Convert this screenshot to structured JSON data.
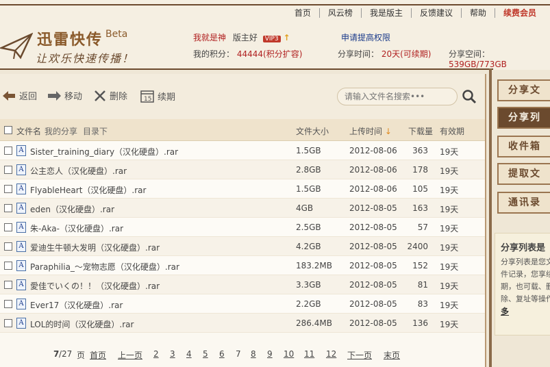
{
  "topnav": {
    "items": [
      {
        "label": "首页",
        "highlight": false
      },
      {
        "label": "风云榜",
        "highlight": false
      },
      {
        "label": "我是版主",
        "highlight": false
      },
      {
        "label": "反馈建议",
        "highlight": false
      },
      {
        "label": "帮助",
        "highlight": false
      },
      {
        "label": "续费会员",
        "highlight": true
      }
    ]
  },
  "logo": {
    "title": "迅雷快传",
    "beta": "Beta",
    "slogan": "让欢乐快速传播！"
  },
  "user": {
    "name": "我就是神",
    "role": "版主好",
    "vip": "VIP3",
    "score_label": "我的积分：",
    "score_value": "44444(积分扩容)",
    "permission_link": "申请提高权限",
    "share_time_label": "分享时间：",
    "share_time_value": "20天(可续期)",
    "space_label": "分享空间：",
    "space_value": "539GB/773GB"
  },
  "toolbar": {
    "back": "返回",
    "move": "移动",
    "delete": "删除",
    "renew": "续期",
    "search_placeholder": "请输入文件名搜索•••"
  },
  "table": {
    "col_name": "文件名",
    "breadcrumb_share": "我的分享",
    "breadcrumb_dir": "目录下",
    "col_size": "文件大小",
    "col_time": "上传时间",
    "sort_arrow": "↓",
    "col_downloads": "下载量",
    "col_valid": "有效期",
    "rows": [
      {
        "name": "Sister_training_diary（汉化硬盘）.rar",
        "size": "1.5GB",
        "time": "2012-08-06",
        "downloads": "363",
        "valid": "19天"
      },
      {
        "name": "公主恋人（汉化硬盘）.rar",
        "size": "2.8GB",
        "time": "2012-08-06",
        "downloads": "178",
        "valid": "19天"
      },
      {
        "name": "FlyableHeart（汉化硬盘）.rar",
        "size": "1.5GB",
        "time": "2012-08-06",
        "downloads": "105",
        "valid": "19天"
      },
      {
        "name": "eden（汉化硬盘）.rar",
        "size": "4GB",
        "time": "2012-08-05",
        "downloads": "163",
        "valid": "19天"
      },
      {
        "name": "朱-Aka-（汉化硬盘）.rar",
        "size": "2.5GB",
        "time": "2012-08-05",
        "downloads": "57",
        "valid": "19天"
      },
      {
        "name": "爱迪生牛顿大发明（汉化硬盘）.rar",
        "size": "4.2GB",
        "time": "2012-08-05",
        "downloads": "2400",
        "valid": "19天"
      },
      {
        "name": "Paraphilia_～宠物志愿（汉化硬盘）.rar",
        "size": "183.2MB",
        "time": "2012-08-05",
        "downloads": "152",
        "valid": "19天"
      },
      {
        "name": "愛佳でいくの！！（汉化硬盘）.rar",
        "size": "3.3GB",
        "time": "2012-08-05",
        "downloads": "81",
        "valid": "19天"
      },
      {
        "name": "Ever17（汉化硬盘）.rar",
        "size": "2.2GB",
        "time": "2012-08-05",
        "downloads": "83",
        "valid": "19天"
      },
      {
        "name": "LOL的时间（汉化硬盘）.rar",
        "size": "286.4MB",
        "time": "2012-08-05",
        "downloads": "136",
        "valid": "19天"
      }
    ]
  },
  "pager": {
    "current": "7",
    "total": "/27",
    "unit": "页",
    "first": "首页",
    "prev": "上一页",
    "pages": [
      "2",
      "3",
      "4",
      "5",
      "6",
      "7",
      "8",
      "9",
      "10",
      "11",
      "12"
    ],
    "next": "下一页",
    "last": "末页"
  },
  "sidebar": {
    "items": [
      "分享文",
      "分享列",
      "收件箱",
      "提取文",
      "通讯录"
    ],
    "active_index": 1,
    "note_title": "分享列表是",
    "note_body": "分享列表是您文件记录，您享续期，也可载、删除、复址等操作",
    "note_more": "多"
  },
  "colors": {
    "brand_brown": "#6b4a2e",
    "accent_red": "#b02020",
    "link_blue": "#1a3a8a"
  }
}
